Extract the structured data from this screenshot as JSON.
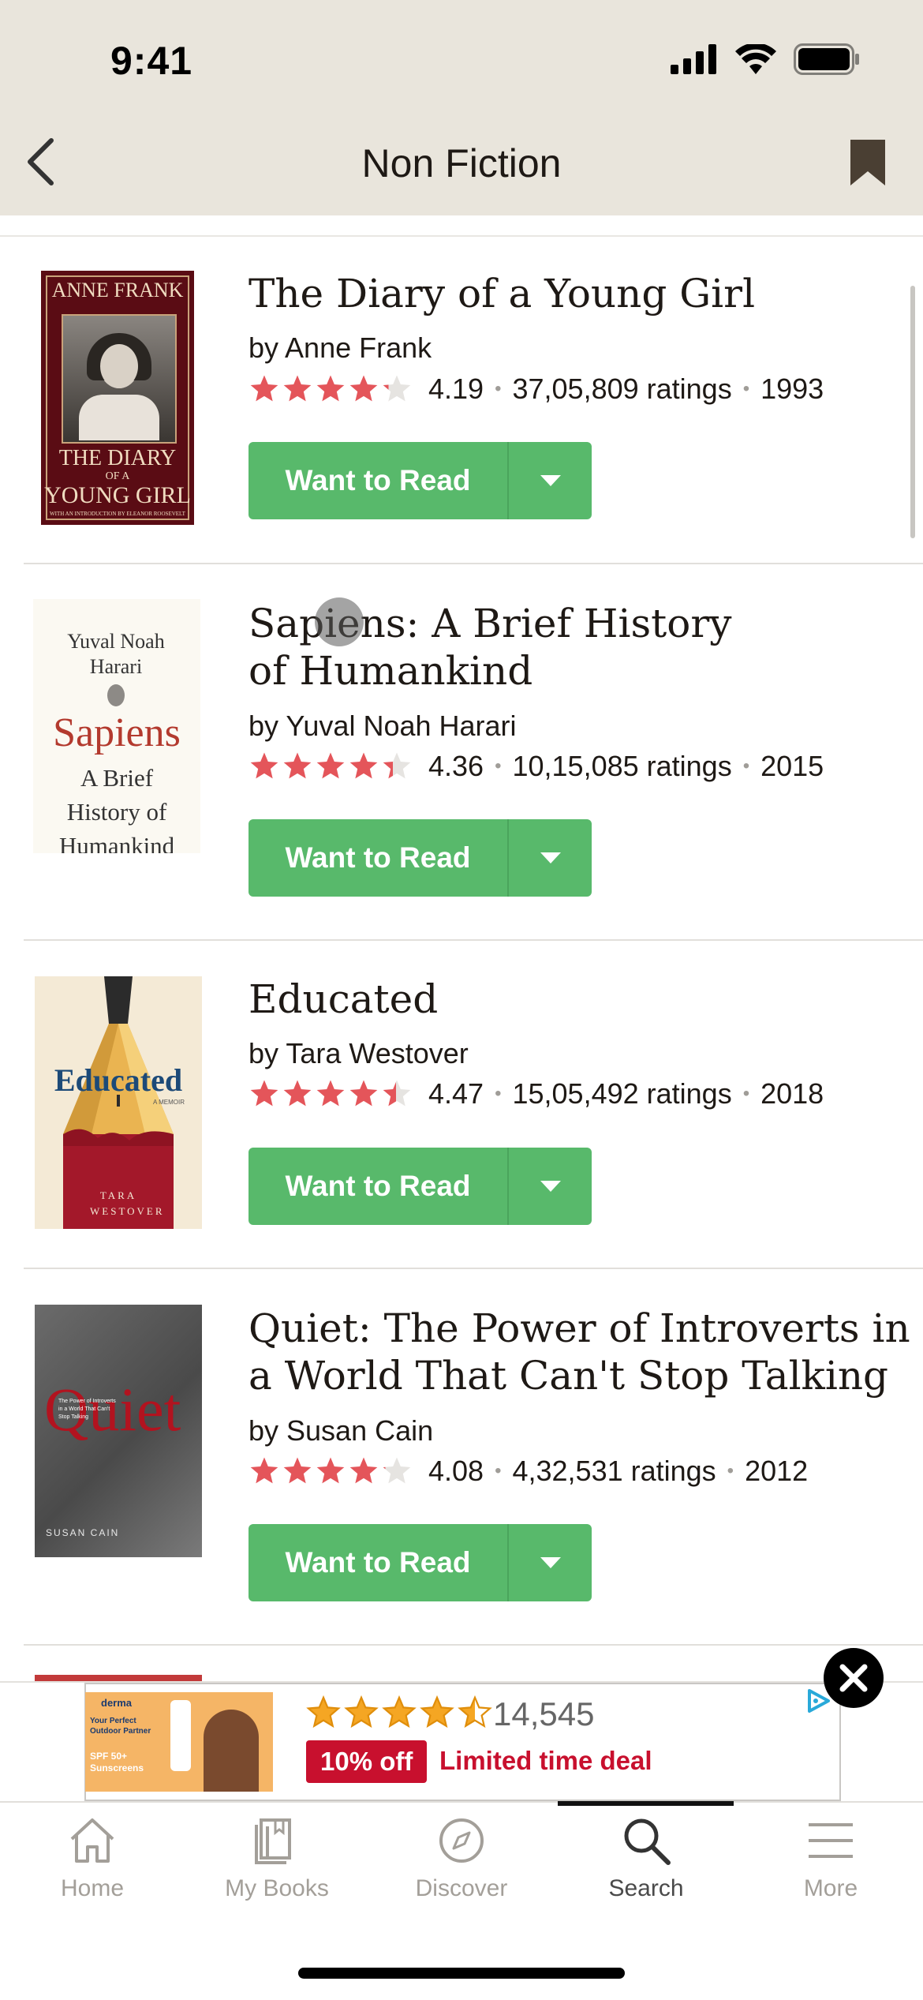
{
  "status_bar": {
    "time": "9:41"
  },
  "header": {
    "title": "Non Fiction"
  },
  "books": [
    {
      "title": "The Diary of a Young Girl",
      "author": "by Anne Frank",
      "rating": "4.19",
      "rating_value": 4.19,
      "ratings_count": "37,05,809 ratings",
      "year": "1993",
      "button": "Want to Read",
      "cover_top": "ANNE FRANK",
      "cover_bottom": "THE DIARY",
      "cover_bottom2": "OF A",
      "cover_bottom3": "YOUNG GIRL",
      "cover_note": "WITH AN INTRODUCTION BY ELEANOR ROOSEVELT"
    },
    {
      "title": "Sapiens: A Brief History of Humankind",
      "author": "by Yuval Noah Harari",
      "rating": "4.36",
      "rating_value": 4.36,
      "ratings_count": "10,15,085 ratings",
      "year": "2015",
      "button": "Want to Read",
      "cover_author": "Yuval Noah Harari",
      "cover_title": "Sapiens",
      "cover_sub": "A Brief History of Humankind"
    },
    {
      "title": "Educated",
      "author": "by Tara Westover",
      "rating": "4.47",
      "rating_value": 4.47,
      "ratings_count": "15,05,492 ratings",
      "year": "2018",
      "button": "Want to Read",
      "cover_title": "Educated",
      "cover_sub": "A MEMOIR",
      "cover_author": "TARA WESTOVER"
    },
    {
      "title": "Quiet: The Power of Introverts in a World That Can't Stop Talking",
      "author": "by Susan Cain",
      "rating": "4.08",
      "rating_value": 4.08,
      "ratings_count": "4,32,531 ratings",
      "year": "2012",
      "button": "Want to Read",
      "cover_title": "Quiet",
      "cover_sub": "The Power of Introverts in a World That Can't Stop Talking",
      "cover_author": "SUSAN CAIN"
    }
  ],
  "ad": {
    "brand": "derma",
    "tagline": "Your Perfect Outdoor Partner",
    "product": "SPF 50+ Sunscreens",
    "rating_value": 4.5,
    "review_count": "14,545",
    "discount": "10% off",
    "deal_text": "Limited time deal"
  },
  "tabs": [
    {
      "label": "Home",
      "icon": "home-icon"
    },
    {
      "label": "My Books",
      "icon": "books-icon"
    },
    {
      "label": "Discover",
      "icon": "compass-icon"
    },
    {
      "label": "Search",
      "icon": "search-icon",
      "active": true
    },
    {
      "label": "More",
      "icon": "menu-icon"
    }
  ],
  "colors": {
    "header_bg": "#e9e5dc",
    "button_green": "#58b96b",
    "star_red": "#e4555a",
    "ad_red": "#c8102e"
  }
}
